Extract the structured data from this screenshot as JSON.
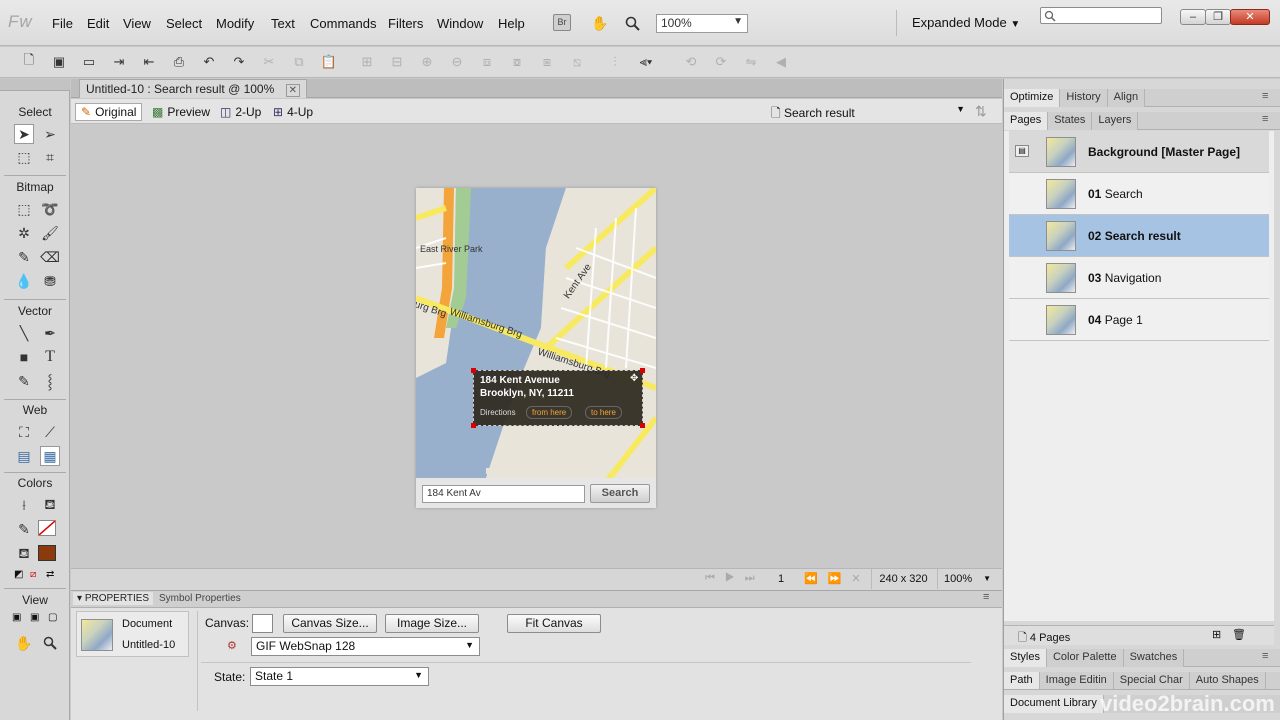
{
  "app": {
    "logo": "Fw"
  },
  "menu": [
    "File",
    "Edit",
    "View",
    "Select",
    "Modify",
    "Text",
    "Commands",
    "Filters",
    "Window",
    "Help"
  ],
  "toolbar_top": {
    "br": "Br",
    "zoom": "100%",
    "mode": "Expanded Mode"
  },
  "document": {
    "tab_title": "Untitled-10 : Search result @ 100%",
    "views": [
      "Original",
      "Preview",
      "2-Up",
      "4-Up"
    ],
    "page_select": "Search result"
  },
  "tools": {
    "sections": [
      "Select",
      "Bitmap",
      "Vector",
      "Web",
      "Colors",
      "View"
    ]
  },
  "map": {
    "street_labels": [
      "East River Park",
      "Kent Ave",
      "Williamsburg Brg",
      "Williamsburg Brg",
      "urg Brg"
    ],
    "popup": {
      "line1": "184 Kent Avenue",
      "line2": "Brooklyn, NY, 11211",
      "directions": "Directions",
      "from": "from here",
      "to": "to here"
    },
    "search_value": "184 Kent Av",
    "search_button": "Search"
  },
  "statusbar": {
    "page_num": "1",
    "dims": "240 x 320",
    "zoom": "100%"
  },
  "properties": {
    "tabs": [
      "PROPERTIES",
      "Symbol Properties"
    ],
    "doc_label": "Document",
    "doc_name": "Untitled-10",
    "canvas_label": "Canvas:",
    "canvas_size_btn": "Canvas Size...",
    "image_size_btn": "Image Size...",
    "fit_canvas_btn": "Fit Canvas",
    "format": "GIF WebSnap 128",
    "state_label": "State:",
    "state_value": "State 1"
  },
  "panels": {
    "top_tabs": [
      "Optimize",
      "History",
      "Align"
    ],
    "sub_tabs": [
      "Pages",
      "States",
      "Layers"
    ],
    "pages": [
      {
        "num": "",
        "name": "Background [Master Page]"
      },
      {
        "num": "01",
        "name": "Search"
      },
      {
        "num": "02",
        "name": "Search result"
      },
      {
        "num": "03",
        "name": "Navigation"
      },
      {
        "num": "04",
        "name": "Page 1"
      }
    ],
    "page_count": "4 Pages",
    "bottom_tabs1": [
      "Styles",
      "Color Palette",
      "Swatches"
    ],
    "bottom_tabs2": [
      "Path",
      "Image Editin",
      "Special Char",
      "Auto Shapes"
    ],
    "bottom_tabs3": [
      "Document Library"
    ]
  },
  "watermark": "video2brain.com",
  "colors": {
    "selected_page": "#a6c3e4",
    "stroke_color": "#8b3a0e"
  }
}
